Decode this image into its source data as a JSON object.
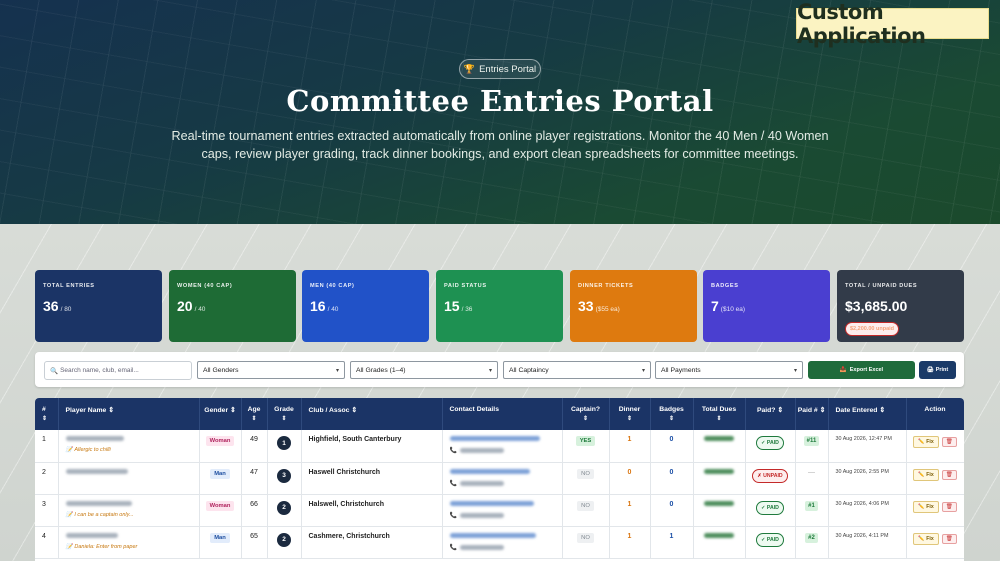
{
  "badge": "Custom Application",
  "hero": {
    "pill": "Entries Portal",
    "title": "Committee Entries Portal",
    "subtitle": "Real-time tournament entries extracted automatically from online player registrations. Monitor the 40 Men / 40 Women caps, review player grading, track dinner bookings, and export clean spreadsheets for committee meetings."
  },
  "stats": [
    {
      "label": "Total Entries",
      "value": "36",
      "sub": "/ 80",
      "color": "#1b3466"
    },
    {
      "label": "Women (40 cap)",
      "value": "20",
      "sub": "/ 40",
      "color": "#1e6b35"
    },
    {
      "label": "Men (40 cap)",
      "value": "16",
      "sub": "/ 40",
      "color": "#2152c8"
    },
    {
      "label": "Paid Status",
      "value": "15",
      "sub": "/ 36",
      "color": "#1e9152"
    },
    {
      "label": "Dinner Tickets",
      "value": "33",
      "sub": "($55 ea)",
      "color": "#de7a0f"
    },
    {
      "label": "Badges",
      "value": "7",
      "sub": "($10 ea)",
      "color": "#4a3fd0"
    },
    {
      "label": "Total / Unpaid Dues",
      "value": "$3,685.00",
      "sub": "",
      "unpaid": "$2,200.00 unpaid",
      "color": "#323b49"
    }
  ],
  "filters": {
    "search_placeholder": "Search name, club, email...",
    "gender": "All Genders",
    "grades": "All Grades (1–4)",
    "captaincy": "All Captaincy",
    "payments": "All Payments",
    "export": "Export Excel",
    "print": "Print"
  },
  "table": {
    "headers": [
      "#",
      "Player Name",
      "Gender",
      "Age",
      "Grade",
      "Club / Assoc",
      "Contact Details",
      "Captain?",
      "Dinner",
      "Badges",
      "Total Dues",
      "Paid?",
      "Paid #",
      "Date Entered",
      "Action"
    ],
    "rows": [
      {
        "num": "1",
        "note": "Allergic to chilli",
        "gender": "Woman",
        "age": "49",
        "grade": "1",
        "club": "Highfield, South Canterbury",
        "captain": "YES",
        "dinner": "1",
        "badges": "0",
        "paid": "✓ PAID",
        "paid_status": "paid",
        "paid_no": "#11",
        "date": "30 Aug 2026, 12:47 PM"
      },
      {
        "num": "2",
        "note": "",
        "gender": "Man",
        "age": "47",
        "grade": "3",
        "club": "Haswell Christchurch",
        "captain": "NO",
        "dinner": "0",
        "badges": "0",
        "paid": "✗ UNPAID",
        "paid_status": "unpaid",
        "paid_no": "—",
        "date": "30 Aug 2026, 2:55 PM"
      },
      {
        "num": "3",
        "note": "I can be a captain only...",
        "gender": "Woman",
        "age": "66",
        "grade": "2",
        "club": "Halswell, Christchurch",
        "captain": "NO",
        "dinner": "1",
        "badges": "0",
        "paid": "✓ PAID",
        "paid_status": "paid",
        "paid_no": "#1",
        "date": "30 Aug 2026, 4:06 PM"
      },
      {
        "num": "4",
        "note": "Daniela: Enter from paper",
        "gender": "Man",
        "age": "65",
        "grade": "2",
        "club": "Cashmere, Christchurch",
        "captain": "NO",
        "dinner": "1",
        "badges": "1",
        "paid": "✓ PAID",
        "paid_status": "paid",
        "paid_no": "#2",
        "date": "30 Aug 2026, 4:11 PM"
      }
    ],
    "fix_label": "Fix"
  }
}
